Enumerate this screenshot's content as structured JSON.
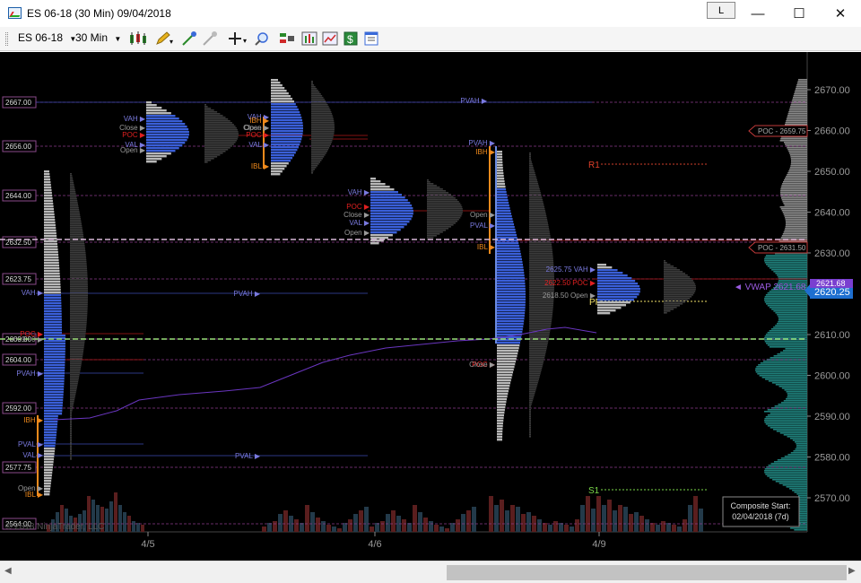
{
  "window": {
    "title": "ES 06-18 (30 Min)  09/04/2018",
    "link_button": "L",
    "minimize_icon": "minimize-icon",
    "maximize_icon": "maximize-icon",
    "close_icon": "close-icon"
  },
  "toolbar": {
    "instrument": "ES 06-18",
    "interval": "30 Min",
    "icons": [
      "bar-style-icon",
      "drawing-tool-icon",
      "global-draw-icon",
      "hide-draw-icon",
      "crosshair-icon",
      "zoom-icon",
      "strategies-icon",
      "indicators-icon",
      "chart-trader-icon",
      "money-icon",
      "properties-icon"
    ]
  },
  "price_axis": {
    "labels": [
      "2670.00",
      "2660.00",
      "2650.00",
      "2640.00",
      "2630.00",
      "2620.00",
      "2610.00",
      "2600.00",
      "2590.00",
      "2580.00",
      "2570.00"
    ],
    "last_price": "2620.25",
    "poc_composite_upper": "POC - 2659.75",
    "poc_composite_lower": "POC - 2631.50",
    "vwap_label": "◄ VWAP  2621.68",
    "vwap_flag": "2621.68"
  },
  "level_labels": [
    "2667.00",
    "2656.00",
    "2644.00",
    "2632.50",
    "2623.75",
    "2609.00",
    "2604.00",
    "2592.00",
    "2577.75",
    "2564.00"
  ],
  "date_labels": [
    "4/5",
    "4/6",
    "4/9"
  ],
  "profile_labels": {
    "p1": [
      "VAH",
      "POC",
      "2609.00",
      "PVAH",
      "IBH",
      "PVAL",
      "VAL",
      "Open",
      "IBL"
    ],
    "p2": [
      "VAH",
      "Close",
      "POC",
      "VAL",
      "Open"
    ],
    "p3": [
      "VAH",
      "IBH",
      "Close",
      "Open",
      "POC",
      "VAL",
      "IBL"
    ],
    "p4": [
      "VAH",
      "POC",
      "Close",
      "VAL",
      "Open"
    ],
    "p5": [
      "PVAH",
      "IBH",
      "PVAL",
      "Open",
      "IBL",
      "POC",
      "Close"
    ],
    "p6": [
      "2625.75 VAH",
      "2622.50 POC",
      "2618.50 Open"
    ],
    "pvah_mid": "PVAH",
    "pval_mid": "PVAL",
    "pvah_top": "PVAH"
  },
  "pivots": {
    "r1": "R1",
    "pp": "PP",
    "s1": "S1"
  },
  "composite_box": {
    "line1": "Composite Start:",
    "line2": "02/04/2018 (7d)"
  },
  "watermark": "© 2018 NinjaTrader, LLC",
  "colors": {
    "background": "#000000",
    "profile_blue": "#3a5fd8",
    "profile_gray": "#9a9a9a",
    "poc_red": "#e02020",
    "ib_orange": "#f08a1c",
    "vwap_purple": "#7a3fd0",
    "teal": "#1f7f7a",
    "level_line": "#8a3a8a"
  }
}
